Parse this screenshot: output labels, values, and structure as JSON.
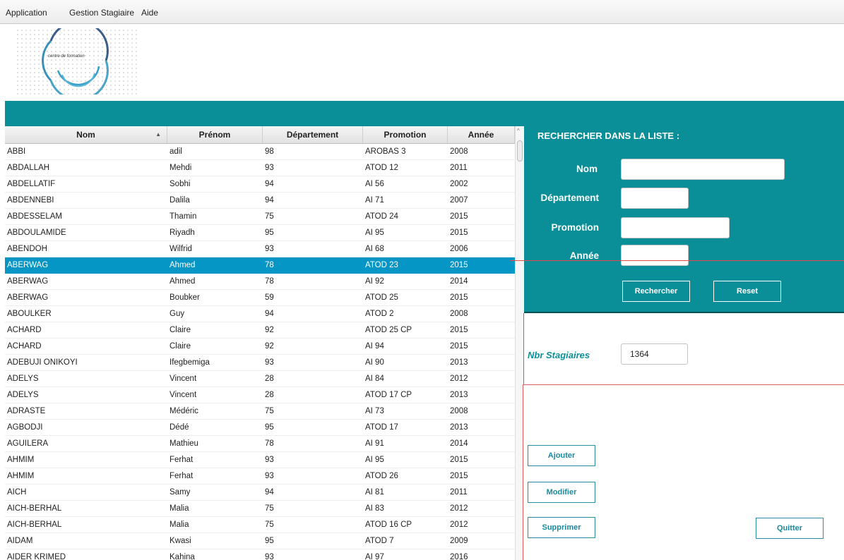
{
  "menu": [
    "Application",
    "Gestion Stagiaire",
    "Aide"
  ],
  "logo": {
    "text": "centre de formation"
  },
  "table": {
    "columns": [
      "Nom",
      "Prénom",
      "Département",
      "Promotion",
      "Année"
    ],
    "sorted_column": "Nom",
    "sort_direction": "ascending",
    "selected_row": 7,
    "rows": [
      [
        "ABBI",
        "adil",
        "98",
        "AROBAS 3",
        "2008"
      ],
      [
        "ABDALLAH",
        "Mehdi",
        "93",
        "ATOD 12",
        "2011"
      ],
      [
        "ABDELLATIF",
        "Sobhi",
        "94",
        "AI 56",
        "2002"
      ],
      [
        "ABDENNEBI",
        "Dalila",
        "94",
        "AI 71",
        "2007"
      ],
      [
        "ABDESSELAM",
        "Thamin",
        "75",
        "ATOD 24",
        "2015"
      ],
      [
        "ABDOULAMIDE",
        "Riyadh",
        "95",
        "AI 95",
        "2015"
      ],
      [
        "ABENDOH",
        "Wilfrid",
        "93",
        "AI 68",
        "2006"
      ],
      [
        "ABERWAG",
        "Ahmed",
        "78",
        "ATOD 23",
        "2015"
      ],
      [
        "ABERWAG",
        "Ahmed",
        "78",
        "AI 92",
        "2014"
      ],
      [
        "ABERWAG",
        "Boubker",
        "59",
        "ATOD 25",
        "2015"
      ],
      [
        "ABOULKER",
        "Guy",
        "94",
        "ATOD 2",
        "2008"
      ],
      [
        "ACHARD",
        "Claire",
        "92",
        "ATOD 25 CP",
        "2015"
      ],
      [
        "ACHARD",
        "Claire",
        "92",
        "AI 94",
        "2015"
      ],
      [
        "ADEBUJI ONIKOYI",
        "Ifegbemiga",
        "93",
        "AI 90",
        "2013"
      ],
      [
        "ADELYS",
        "Vincent",
        "28",
        "AI 84",
        "2012"
      ],
      [
        "ADELYS",
        "Vincent",
        "28",
        "ATOD 17 CP",
        "2013"
      ],
      [
        "ADRASTE",
        "Médéric",
        "75",
        "AI 73",
        "2008"
      ],
      [
        "AGBODJI",
        "Dédé",
        "95",
        "ATOD 17",
        "2013"
      ],
      [
        "AGUILERA",
        "Mathieu",
        "78",
        "AI 91",
        "2014"
      ],
      [
        "AHMIM",
        "Ferhat",
        "93",
        "AI 95",
        "2015"
      ],
      [
        "AHMIM",
        "Ferhat",
        "93",
        "ATOD 26",
        "2015"
      ],
      [
        "AICH",
        "Samy",
        "94",
        "AI 81",
        "2011"
      ],
      [
        "AICH-BERHAL",
        "Malia",
        "75",
        "AI 83",
        "2012"
      ],
      [
        "AICH-BERHAL",
        "Malia",
        "75",
        "ATOD 16 CP",
        "2012"
      ],
      [
        "AIDAM",
        "Kwasi",
        "95",
        "ATOD 7",
        "2009"
      ],
      [
        "AIDER KRIMED",
        "Kahina",
        "93",
        "AI 97",
        "2016"
      ]
    ]
  },
  "search": {
    "title": "RECHERCHER DANS LA LISTE :",
    "nom_label": "Nom",
    "departement_label": "Département",
    "promotion_label": "Promotion",
    "annee_label": "Année",
    "nom_value": "",
    "departement_value": "",
    "promotion_value": "",
    "annee_value": "",
    "rechercher_label": "Rechercher",
    "reset_label": "Reset"
  },
  "count": {
    "label": "Nbr Stagiaires",
    "value": "1364"
  },
  "actions": {
    "ajouter_label": "Ajouter",
    "modifier_label": "Modifier",
    "supprimer_label": "Supprimer",
    "quitter_label": "Quitter"
  },
  "colors": {
    "teal": "#0a8f99",
    "selection": "#0596c5",
    "button_text": "#1a8aa0"
  }
}
